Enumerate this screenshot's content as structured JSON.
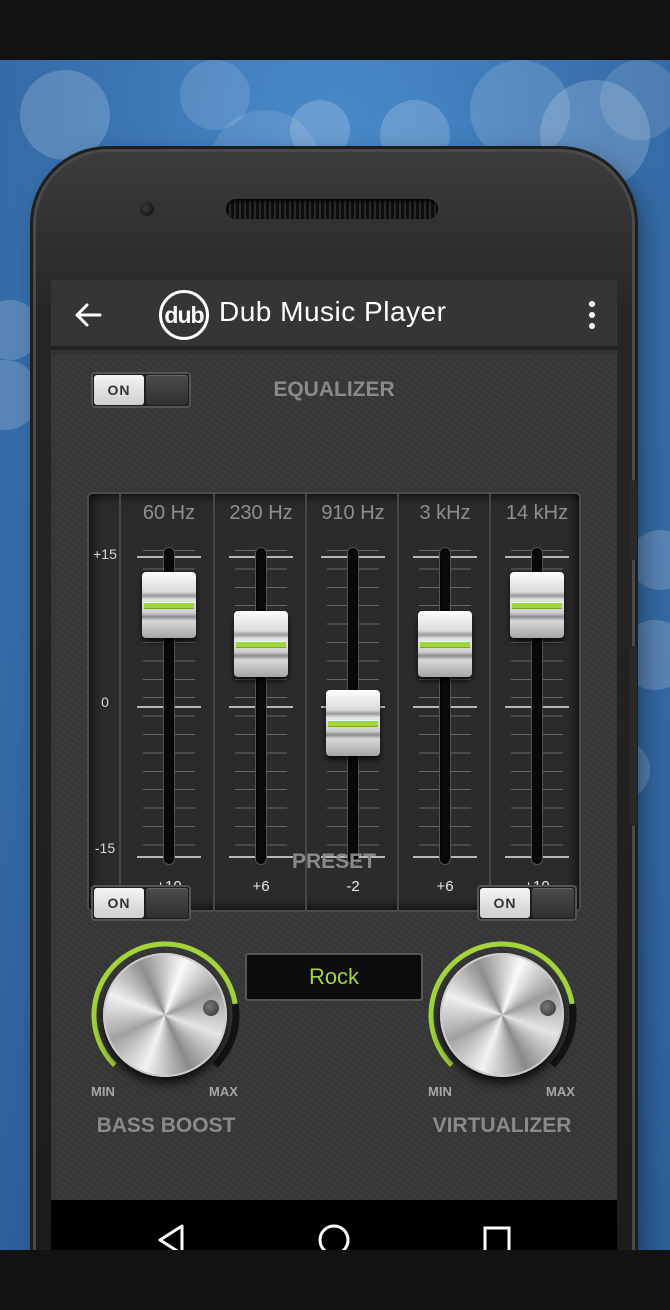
{
  "app": {
    "title": "Dub Music Player",
    "logo_text": "dub"
  },
  "equalizer": {
    "label": "EQUALIZER",
    "toggle_label": "ON",
    "db_labels": [
      "+15",
      "0",
      "-15"
    ],
    "bands": [
      {
        "freq": "60 Hz",
        "gain": "+10",
        "level": 10
      },
      {
        "freq": "230 Hz",
        "gain": "+6",
        "level": 6
      },
      {
        "freq": "910 Hz",
        "gain": "-2",
        "level": -2
      },
      {
        "freq": "3 kHz",
        "gain": "+6",
        "level": 6
      },
      {
        "freq": "14 kHz",
        "gain": "+10",
        "level": 10
      }
    ]
  },
  "preset": {
    "label": "PRESET",
    "value": "Rock"
  },
  "bass_boost": {
    "label": "BASS BOOST",
    "toggle_label": "ON",
    "min": "MIN",
    "max": "MAX",
    "level": 0.8
  },
  "virtualizer": {
    "label": "VIRTUALIZER",
    "toggle_label": "ON",
    "min": "MIN",
    "max": "MAX",
    "level": 0.8
  },
  "colors": {
    "accent": "#a4d43c",
    "background": "#3c76b4"
  },
  "icons": {
    "back": "arrow-left-icon",
    "menu": "more-vert-icon",
    "nav_back": "triangle-back-icon",
    "nav_home": "circle-home-icon",
    "nav_recents": "square-recents-icon"
  }
}
